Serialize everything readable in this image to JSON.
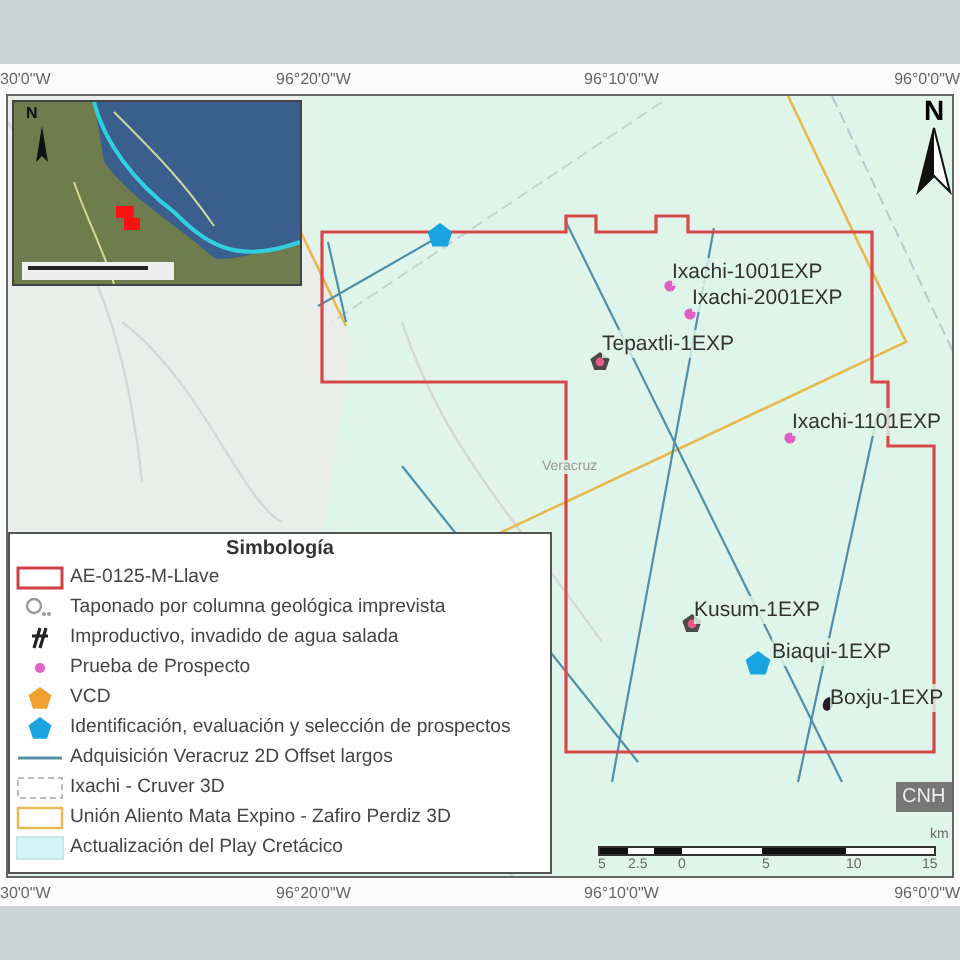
{
  "map": {
    "axis_top": [
      "30'0\"W",
      "96°20'0\"W",
      "96°10'0\"W",
      "96°0'0\"W"
    ],
    "axis_bottom": [
      "30'0\"W",
      "96°20'0\"W",
      "96°10'0\"W",
      "96°0'0\"W"
    ],
    "inset": {
      "north": "N"
    },
    "north": "N",
    "place_label": "Veracruz",
    "wells": [
      {
        "label": "Ixachi-1001EXP",
        "kind": "prospect-test"
      },
      {
        "label": "Ixachi-2001EXP",
        "kind": "prospect-test"
      },
      {
        "label": "Tepaxtli-1EXP",
        "kind": "plugged"
      },
      {
        "label": "Ixachi-1101EXP",
        "kind": "prospect-test"
      },
      {
        "label": "Kusum-1EXP",
        "kind": "plugged"
      },
      {
        "label": "Biaqui-1EXP",
        "kind": "identification"
      },
      {
        "label": "Boxju-1EXP",
        "kind": "unproductive"
      }
    ],
    "legend": {
      "title": "Simbología",
      "items": [
        {
          "label": "AE-0125-M-Llave",
          "kind": "area-outline"
        },
        {
          "label": "Taponado por columna geológica imprevista",
          "kind": "plugged"
        },
        {
          "label": "Improductivo, invadido de agua salada",
          "kind": "unproductive"
        },
        {
          "label": "Prueba de Prospecto",
          "kind": "prospect-test"
        },
        {
          "label": "VCD",
          "kind": "vcd"
        },
        {
          "label": "Identificación, evaluación y selección de prospectos",
          "kind": "identification"
        },
        {
          "label": "Adquisición Veracruz 2D Offset largos",
          "kind": "seismic-line"
        },
        {
          "label": "Ixachi - Cruver 3D",
          "kind": "survey-dashed"
        },
        {
          "label": "Unión Aliento Mata Expino - Zafiro Perdiz 3D",
          "kind": "survey-orange"
        },
        {
          "label": "Actualización del Play Cretácico",
          "kind": "play-area"
        }
      ]
    },
    "scale_bar": {
      "labels": [
        "5",
        "2.5",
        "0",
        "5",
        "10",
        "15"
      ],
      "unit": "km"
    },
    "logo": "CNH"
  }
}
